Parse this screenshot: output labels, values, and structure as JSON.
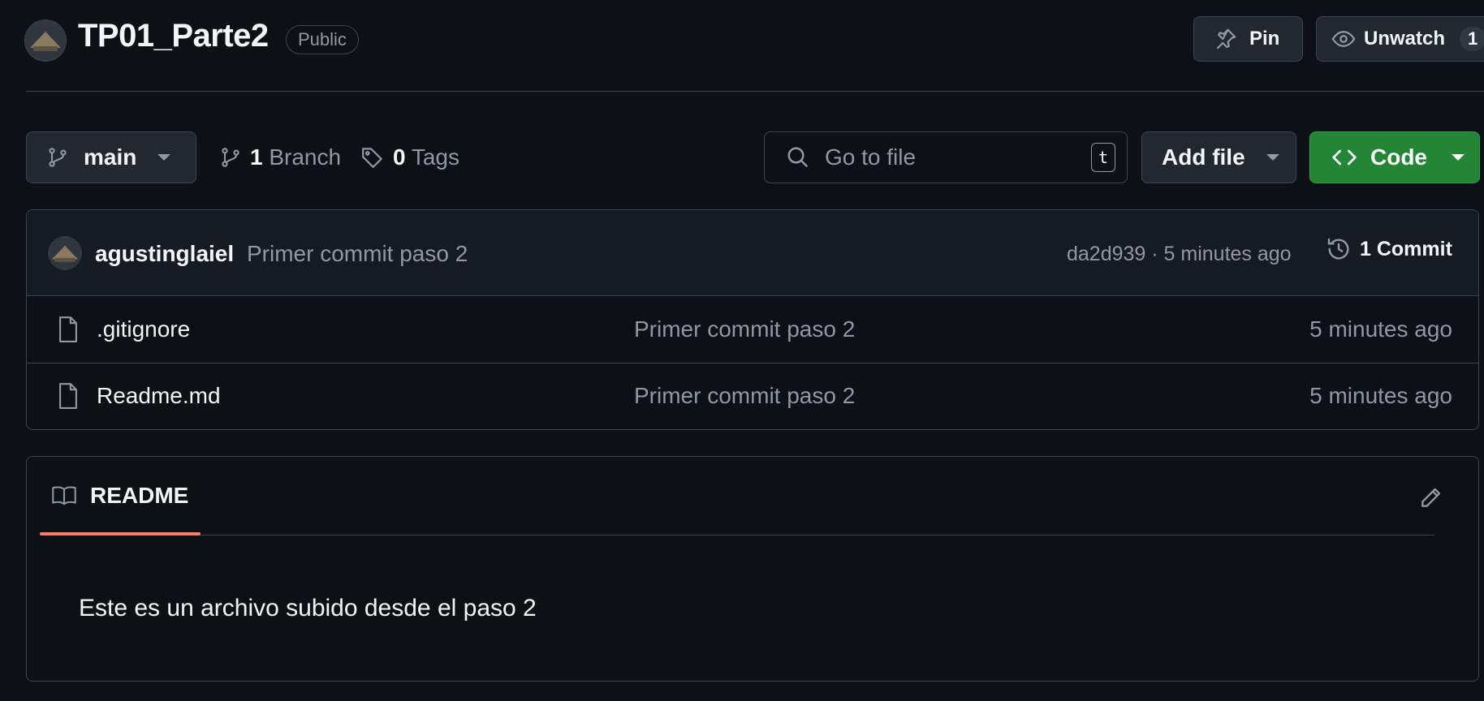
{
  "repo": {
    "name": "TP01_Parte2",
    "visibility": "Public"
  },
  "header_actions": {
    "pin_label": "Pin",
    "watch_label": "Unwatch",
    "watch_count": "1"
  },
  "toolbar": {
    "branch": "main",
    "branches_count": "1",
    "branches_label": "Branch",
    "tags_count": "0",
    "tags_label": "Tags",
    "search_placeholder": "Go to file",
    "search_shortcut": "t",
    "add_file_label": "Add file",
    "code_label": "Code"
  },
  "latest_commit": {
    "author": "agustinglaiel",
    "message": "Primer commit paso 2",
    "sha_time": "da2d939 · 5 minutes ago",
    "commits_label": "1 Commit"
  },
  "files": [
    {
      "name": ".gitignore",
      "commit": "Primer commit paso 2",
      "time": "5 minutes ago"
    },
    {
      "name": "Readme.md",
      "commit": "Primer commit paso 2",
      "time": "5 minutes ago"
    }
  ],
  "readme": {
    "tab_label": "README",
    "body": "Este es un archivo subido desde el paso 2"
  },
  "colors": {
    "background": "#0d1117",
    "border": "#3d444d",
    "code_button": "#238636",
    "tab_accent": "#f78166"
  },
  "icons": [
    "avatar",
    "pin-icon",
    "eye-icon",
    "git-branch-icon",
    "tag-icon",
    "search-icon",
    "code-icon",
    "history-icon",
    "file-icon",
    "book-icon",
    "pencil-icon"
  ]
}
